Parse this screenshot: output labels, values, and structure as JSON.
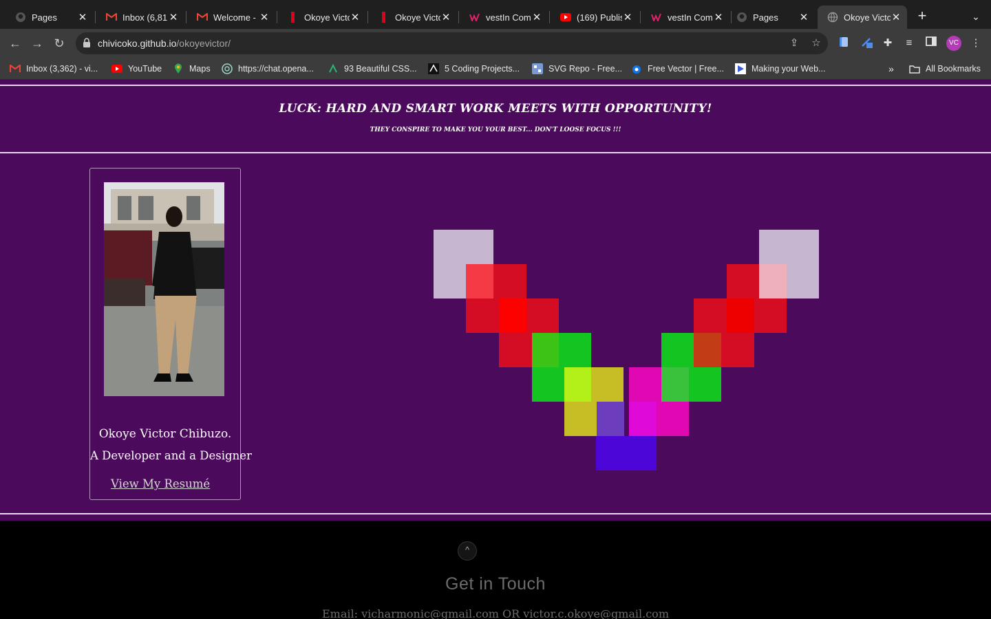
{
  "browser": {
    "tabs": [
      {
        "title": "Pages",
        "icon": "github-icon",
        "active": false
      },
      {
        "title": "Inbox (6,81",
        "icon": "gmail-icon",
        "active": false
      },
      {
        "title": "Welcome - ",
        "icon": "gmail-icon",
        "active": false
      },
      {
        "title": "Okoye Victo",
        "icon": "red-bar-icon",
        "active": false
      },
      {
        "title": "Okoye Victo",
        "icon": "red-bar-icon",
        "active": false
      },
      {
        "title": "vestIn Comp",
        "icon": "vestin-icon",
        "active": false
      },
      {
        "title": "(169) Publis",
        "icon": "youtube-icon",
        "active": false
      },
      {
        "title": "vestIn Comp",
        "icon": "vestin-icon",
        "active": false
      },
      {
        "title": "Pages",
        "icon": "github-icon",
        "active": false
      },
      {
        "title": "Okoye Victo",
        "icon": "globe-icon",
        "active": true
      }
    ],
    "url_domain": "chivicoko.github.io",
    "url_path": "/okoyevictor/",
    "profile_initials": "VC",
    "bookmarks": [
      {
        "label": "Inbox (3,362) - vi...",
        "icon": "gmail-icon"
      },
      {
        "label": "YouTube",
        "icon": "youtube-icon"
      },
      {
        "label": "Maps",
        "icon": "maps-icon"
      },
      {
        "label": "https://chat.opena...",
        "icon": "openai-icon"
      },
      {
        "label": "93 Beautiful CSS...",
        "icon": "css-icon"
      },
      {
        "label": "5 Coding Projects...",
        "icon": "coding-icon"
      },
      {
        "label": "SVG Repo - Free...",
        "icon": "svgrepo-icon"
      },
      {
        "label": "Free Vector | Free...",
        "icon": "freepik-icon"
      },
      {
        "label": "Making your Web...",
        "icon": "web-icon"
      }
    ],
    "bookmarks_overflow": "»",
    "all_bookmarks": "All Bookmarks"
  },
  "header": {
    "motto": "Luck: Hard and smart work meets with opportunity!",
    "submotto": "They conspire to make you your best... Don't loose focus !!!"
  },
  "profile": {
    "name": "Okoye Victor Chibuzo.",
    "role": "A Developer and a Designer",
    "resume_link": "View My Resumé"
  },
  "pixel_art": {
    "colors": [
      "#c7b6d0",
      "#f63a45",
      "#d40c24",
      "#fd0000",
      "#3cc316",
      "#14c421",
      "#b3f01a",
      "#c6be24",
      "#e008b3",
      "#3bc23c",
      "#6c3ebd",
      "#df0ad8",
      "#4c07d8",
      "#ef0000",
      "#c23c16",
      "#eeb1bc"
    ]
  },
  "footer": {
    "back_to_top": "^",
    "heading": "Get in Touch",
    "emails": "Email: vicharmonic@gmail.com OR victor.c.okoye@gmail.com"
  }
}
